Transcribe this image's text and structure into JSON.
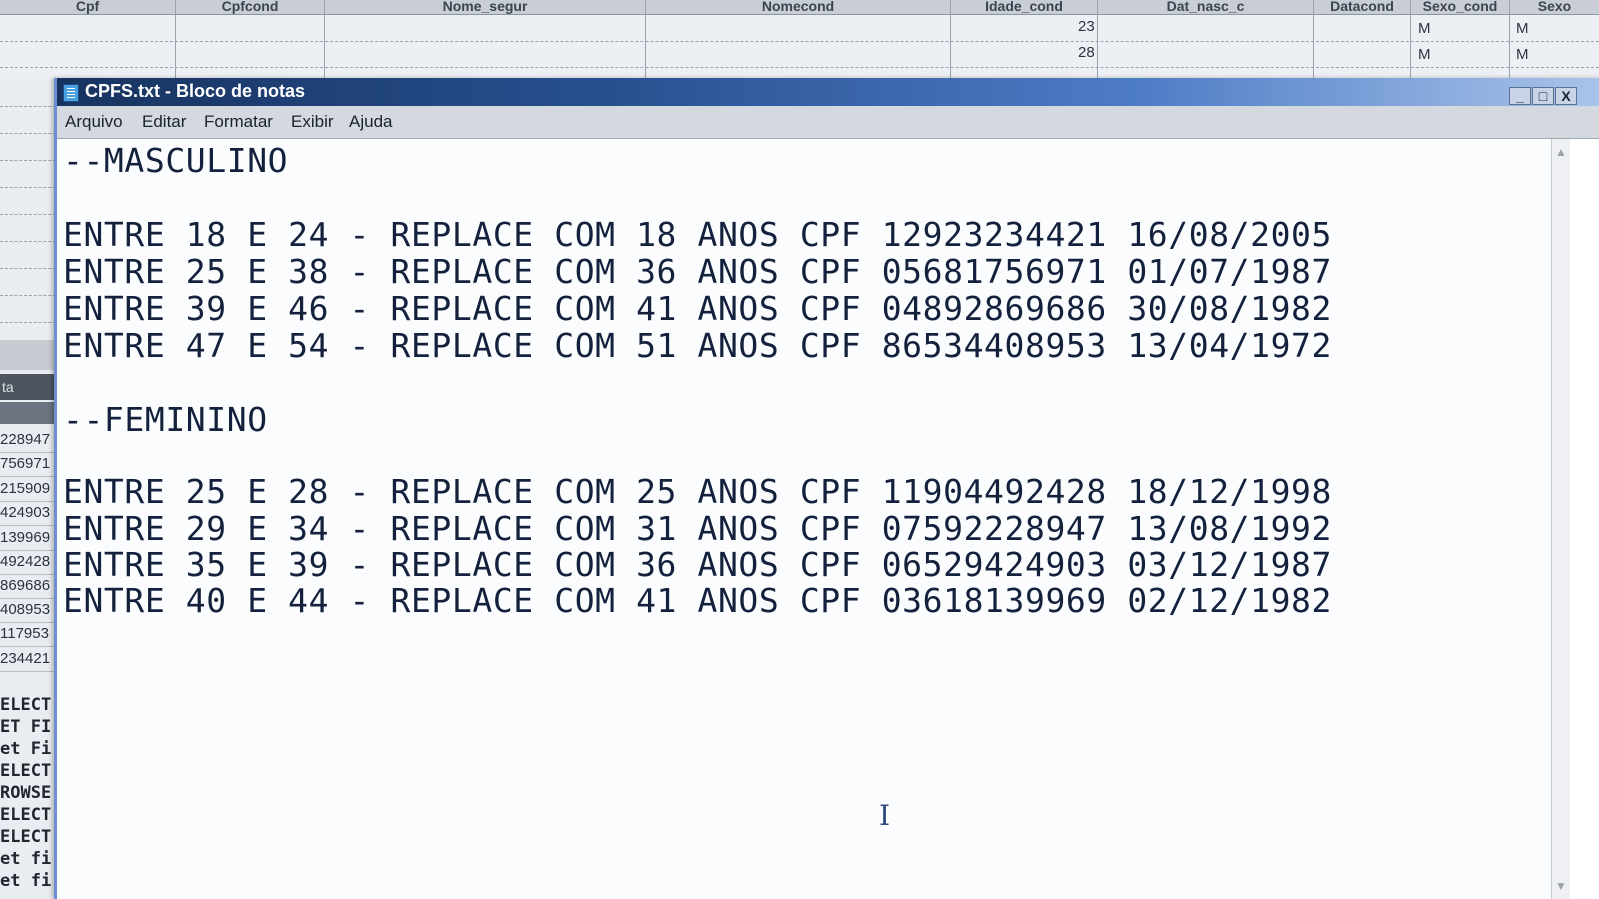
{
  "spreadsheet": {
    "columns": [
      "Cpf",
      "Cpfcond",
      "Nome_segur",
      "Nomecond",
      "Idade_cond",
      "Dat_nasc_c",
      "Datacond",
      "Sexo_cond",
      "Sexo"
    ],
    "rows": [
      {
        "idade": "23",
        "sexo_cond": "M",
        "sexo": "M"
      },
      {
        "idade": "28",
        "sexo_cond": "M",
        "sexo": "M"
      }
    ],
    "left_tab_label": "ta",
    "left_numbers": [
      "228947",
      "756971",
      "215909",
      "424903",
      "139969",
      "492428",
      "869686",
      "408953",
      "117953",
      "234421"
    ],
    "left_code": [
      "ELECT",
      "ET FI",
      "et Fi",
      "ELECT",
      "ROWSE",
      "ELECT",
      "ELECT",
      "et fi",
      "et fi"
    ]
  },
  "notepad": {
    "title": "CPFS.txt - Bloco de notas",
    "window_buttons": {
      "minimize": "_",
      "maximize": "□",
      "close": "X"
    },
    "menu": [
      "Arquivo",
      "Editar",
      "Formatar",
      "Exibir",
      "Ajuda"
    ],
    "lines": [
      "--MASCULINO",
      "",
      "ENTRE 18 E 24 - REPLACE COM 18 ANOS CPF 12923234421 16/08/2005",
      "ENTRE 25 E 38 - REPLACE COM 36 ANOS CPF 05681756971 01/07/1987",
      "ENTRE 39 E 46 - REPLACE COM 41 ANOS CPF 04892869686 30/08/1982",
      "ENTRE 47 E 54 - REPLACE COM 51 ANOS CPF 86534408953 13/04/1972",
      "",
      "--FEMININO",
      "",
      "ENTRE 25 E 28 - REPLACE COM 25 ANOS CPF 11904492428 18/12/1998",
      "ENTRE 29 E 34 - REPLACE COM 31 ANOS CPF 07592228947 13/08/1992",
      "ENTRE 35 E 39 - REPLACE COM 36 ANOS CPF 06529424903 03/12/1987",
      "ENTRE 40 E 44 - REPLACE COM 41 ANOS CPF 03618139969 02/12/1982"
    ],
    "text_cursor": "I"
  },
  "colors": {
    "titlebar_start": "#17335f",
    "titlebar_end": "#a9c4ea",
    "text": "#14213d"
  }
}
